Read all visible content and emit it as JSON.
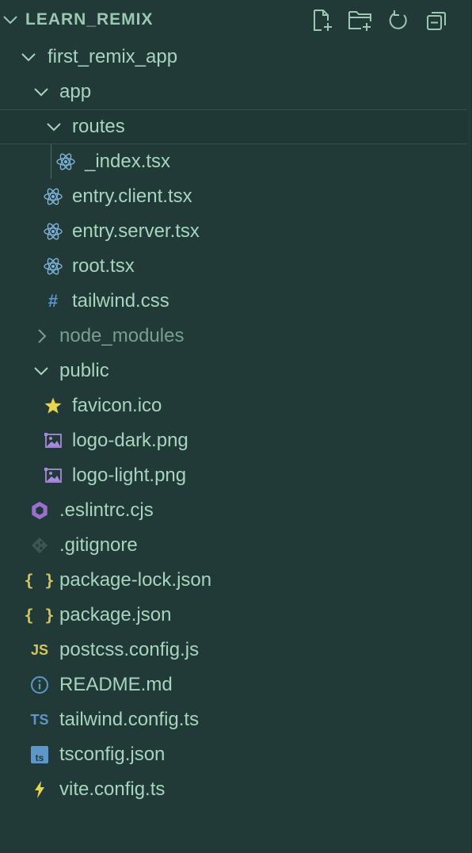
{
  "explorer": {
    "title": "LEARN_REMIX",
    "actions": [
      "new-file-icon",
      "new-folder-icon",
      "refresh-icon",
      "collapse-all-icon"
    ]
  },
  "tree": [
    {
      "label": "first_remix_app",
      "icon": "chevron-down-icon",
      "kind": "folder-open"
    },
    {
      "label": "app",
      "icon": "chevron-down-icon",
      "kind": "folder-open"
    },
    {
      "label": "routes",
      "icon": "chevron-down-icon",
      "kind": "folder-open",
      "selected": true
    },
    {
      "label": "_index.tsx",
      "icon": "react-icon",
      "kind": "file"
    },
    {
      "label": "entry.client.tsx",
      "icon": "react-icon",
      "kind": "file"
    },
    {
      "label": "entry.server.tsx",
      "icon": "react-icon",
      "kind": "file"
    },
    {
      "label": "root.tsx",
      "icon": "react-icon",
      "kind": "file"
    },
    {
      "label": "tailwind.css",
      "icon": "css-hash-icon",
      "kind": "file"
    },
    {
      "label": "node_modules",
      "icon": "chevron-right-icon",
      "kind": "folder-closed",
      "dimmed": true
    },
    {
      "label": "public",
      "icon": "chevron-down-icon",
      "kind": "folder-open"
    },
    {
      "label": "favicon.ico",
      "icon": "star-icon",
      "kind": "file"
    },
    {
      "label": "logo-dark.png",
      "icon": "image-icon",
      "kind": "file"
    },
    {
      "label": "logo-light.png",
      "icon": "image-icon",
      "kind": "file"
    },
    {
      "label": ".eslintrc.cjs",
      "icon": "eslint-icon",
      "kind": "file"
    },
    {
      "label": ".gitignore",
      "icon": "git-icon",
      "kind": "file"
    },
    {
      "label": "package-lock.json",
      "icon": "json-braces-icon",
      "kind": "file"
    },
    {
      "label": "package.json",
      "icon": "json-braces-icon",
      "kind": "file"
    },
    {
      "label": "postcss.config.js",
      "icon": "javascript-icon",
      "kind": "file"
    },
    {
      "label": "README.md",
      "icon": "info-icon",
      "kind": "file"
    },
    {
      "label": "tailwind.config.ts",
      "icon": "typescript-icon",
      "kind": "file"
    },
    {
      "label": "tsconfig.json",
      "icon": "tsconfig-icon",
      "kind": "file"
    },
    {
      "label": "vite.config.ts",
      "icon": "vite-bolt-icon",
      "kind": "file"
    }
  ],
  "colors": {
    "background": "#213a37",
    "text": "#a8d4bf",
    "react": "#7fb4d8",
    "image": "#a78bd8",
    "json": "#d7c55a",
    "typescript": "#5b97c8",
    "eslint": "#9b6fd1"
  },
  "glyphs": {
    "braces": "{ }",
    "js": "JS",
    "ts": "TS",
    "ts_small": "ts",
    "hash": "#",
    "info": "i"
  }
}
